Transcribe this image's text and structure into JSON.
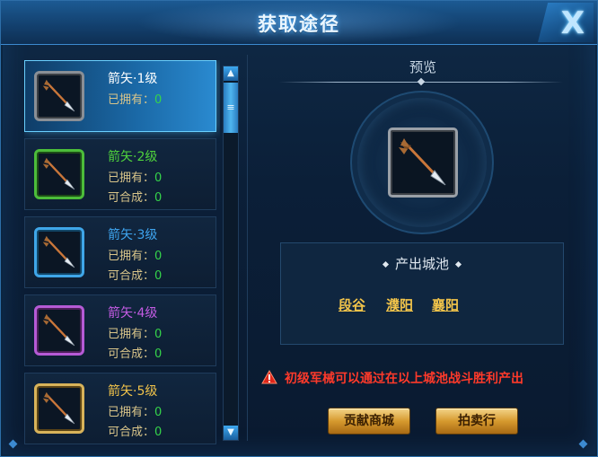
{
  "window": {
    "title": "获取途径",
    "close_glyph": "X"
  },
  "list": {
    "items": [
      {
        "name": "箭矢·1级",
        "name_color": "#ffffff",
        "frame": "gray",
        "owned_label": "已拥有：",
        "owned": "0",
        "combine_label": "",
        "combine": "",
        "selected": true
      },
      {
        "name": "箭矢·2级",
        "name_color": "#4fd23c",
        "frame": "green",
        "owned_label": "已拥有：",
        "owned": "0",
        "combine_label": "可合成：",
        "combine": "0"
      },
      {
        "name": "箭矢·3级",
        "name_color": "#3ea4ee",
        "frame": "blue",
        "owned_label": "已拥有：",
        "owned": "0",
        "combine_label": "可合成：",
        "combine": "0"
      },
      {
        "name": "箭矢·4级",
        "name_color": "#c25be2",
        "frame": "purple",
        "owned_label": "已拥有：",
        "owned": "0",
        "combine_label": "可合成：",
        "combine": "0"
      },
      {
        "name": "箭矢·5级",
        "name_color": "#f0c24a",
        "frame": "gold",
        "owned_label": "已拥有：",
        "owned": "0",
        "combine_label": "可合成：",
        "combine": "0"
      }
    ],
    "scroll_thumb_glyph": "≡",
    "scroll_up_glyph": "▲",
    "scroll_down_glyph": "▼"
  },
  "preview": {
    "label": "预览",
    "origin_title": "产出城池",
    "cities": [
      "段谷",
      "濮阳",
      "襄阳"
    ]
  },
  "notice": "初级军械可以通过在以上城池战斗胜利产出",
  "buttons": {
    "contribution_shop": "贡献商城",
    "auction_house": "拍卖行"
  }
}
